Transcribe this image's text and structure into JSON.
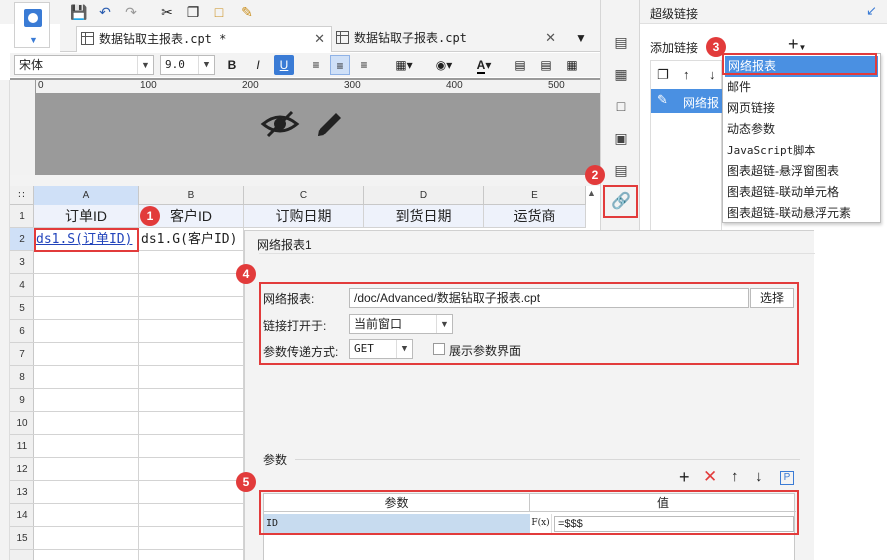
{
  "toolbar": {
    "icons": [
      "save-icon",
      "undo-icon",
      "redo-icon",
      "cut-icon",
      "copy-icon",
      "paste-icon",
      "format-brush-icon"
    ]
  },
  "tabs": [
    {
      "label": "数据钻取主报表.cpt *",
      "active": true
    },
    {
      "label": "数据钻取子报表.cpt",
      "active": false
    }
  ],
  "format": {
    "font_name": "宋体",
    "font_size": "9.0",
    "bold": "B",
    "italic": "I",
    "underline": "U",
    "font_color": "A"
  },
  "ruler": {
    "ticks": [
      "0",
      "100",
      "200",
      "300",
      "400",
      "500"
    ]
  },
  "sheet": {
    "columns": [
      "A",
      "B",
      "C",
      "D",
      "E"
    ],
    "rows": [
      "1",
      "2",
      "3",
      "4",
      "5",
      "6",
      "7",
      "8",
      "9",
      "10",
      "11",
      "12",
      "13",
      "14",
      "15"
    ],
    "header_row": [
      "订单ID",
      "客户ID",
      "订购日期",
      "到货日期",
      "运货商"
    ],
    "data_row": [
      "ds1.S(订单ID)",
      "ds1.G(客户ID)"
    ]
  },
  "right_panel": {
    "title": "超级链接",
    "add_link_label": "添加链接",
    "add_button": "+",
    "list_item": "网络报"
  },
  "menu": {
    "items": [
      "网络报表",
      "邮件",
      "网页链接",
      "动态参数",
      "JavaScript脚本",
      "图表超链-悬浮窗图表",
      "图表超链-联动单元格",
      "图表超链-联动悬浮元素"
    ]
  },
  "dialog": {
    "name": "网络报表1",
    "report_label": "网络报表:",
    "report_path": "/doc/Advanced/数据钻取子报表.cpt",
    "choose_button": "选择",
    "open_label": "链接打开于:",
    "open_value": "当前窗口",
    "param_mode_label": "参数传递方式:",
    "param_mode_value": "GET",
    "show_param_label": "展示参数界面",
    "params_section": "参数",
    "table_headers": [
      "参数",
      "值"
    ],
    "param_row": {
      "name": "ID",
      "value": "=$$$",
      "formula_icon": "F(x)"
    }
  },
  "callouts": [
    "1",
    "2",
    "3",
    "4",
    "5"
  ],
  "colors": {
    "accent": "#3a7bd5",
    "highlight": "#e23b3b",
    "selected": "#4a90e2"
  }
}
